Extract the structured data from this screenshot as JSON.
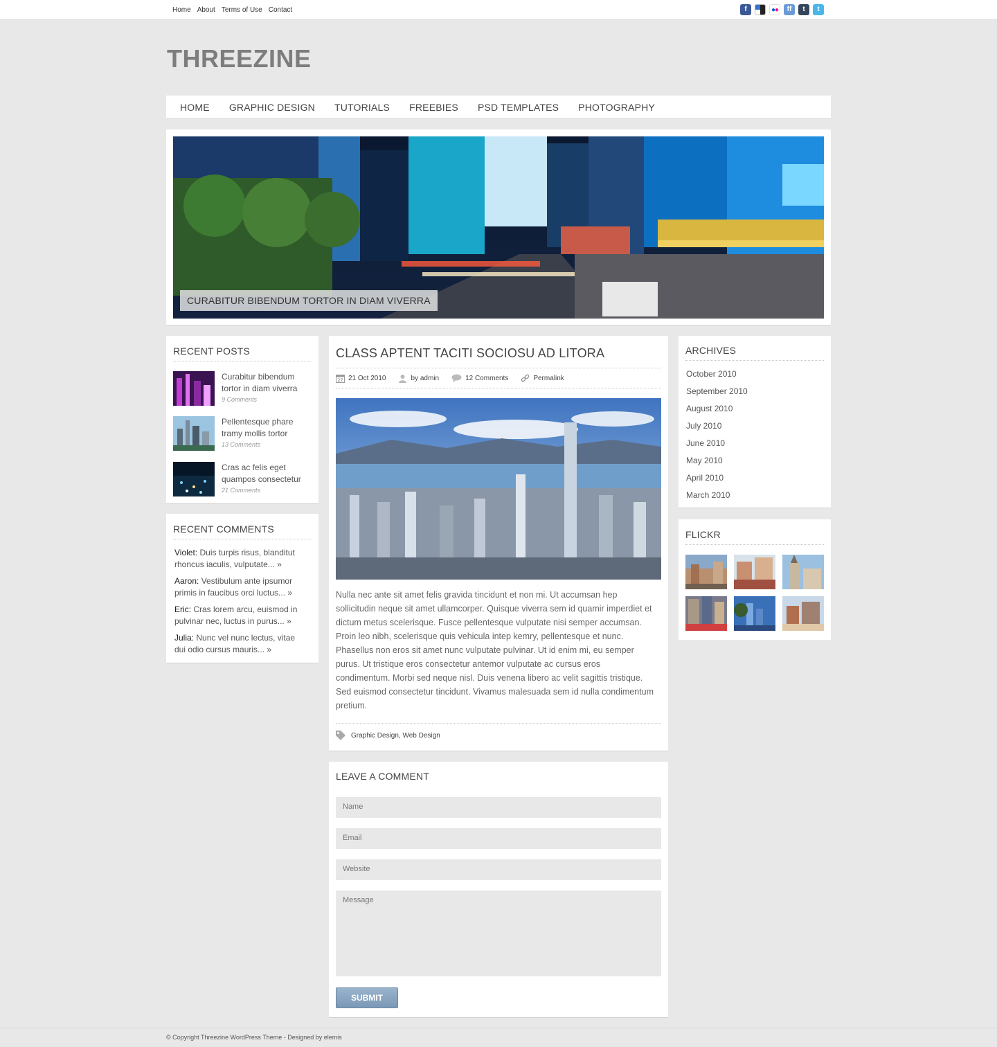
{
  "topbar": {
    "links": [
      "Home",
      "About",
      "Terms of Use",
      "Contact"
    ],
    "social_icons": [
      "facebook-icon",
      "delicious-icon",
      "flickr-icon",
      "friendfeed-icon",
      "tumblr-icon",
      "twitter-icon"
    ]
  },
  "site": {
    "logo": "THREEZINE"
  },
  "nav": {
    "items": [
      "HOME",
      "GRAPHIC DESIGN",
      "TUTORIALS",
      "FREEBIES",
      "PSD TEMPLATES",
      "PHOTOGRAPHY"
    ]
  },
  "slider": {
    "caption": "CURABITUR BIBENDUM TORTOR IN DIAM VIVERRA"
  },
  "recent_posts": {
    "title": "RECENT POSTS",
    "items": [
      {
        "title": "Curabitur bibendum tortor in diam viverra",
        "comments": "9 Comments"
      },
      {
        "title": "Pellentesque phare tramy mollis tortor",
        "comments": "13 Comments"
      },
      {
        "title": "Cras ac felis eget quampos consectetur",
        "comments": "21 Comments"
      }
    ]
  },
  "recent_comments": {
    "title": "RECENT COMMENTS",
    "items": [
      {
        "author": "Violet:",
        "text": "Duis turpis risus, blanditut rhoncus iaculis, vulputate...",
        "more": "»"
      },
      {
        "author": "Aaron:",
        "text": "Vestibulum ante ipsumor primis in faucibus orci luctus...",
        "more": "»"
      },
      {
        "author": "Eric:",
        "text": "Cras lorem arcu, euismod in pulvinar nec, luctus in purus...",
        "more": "»"
      },
      {
        "author": "Julia:",
        "text": "Nunc vel nunc lectus, vitae dui odio cursus mauris...",
        "more": "»"
      }
    ]
  },
  "post": {
    "title": "CLASS APTENT TACITI SOCIOSU AD LITORA",
    "date_icon_day": "27",
    "date": "21 Oct 2010",
    "author": "by admin",
    "comments": "12 Comments",
    "permalink": "Permalink",
    "body": "Nulla nec ante sit amet felis gravida tincidunt et non mi. Ut accumsan hep sollicitudin neque sit amet ullamcorper. Quisque viverra sem id quamir imperdiet et dictum metus scelerisque. Fusce pellentesque vulputate nisi semper accumsan. Proin leo nibh, scelerisque quis vehicula intep kemry, pellentesque et nunc. Phasellus non eros sit amet nunc vulputate pulvinar. Ut id enim mi, eu semper purus. Ut tristique eros consectetur antemor vulputate ac cursus eros condimentum. Morbi sed neque nisl. Duis venena libero ac velit sagittis tristique. Sed euismod consectetur tincidunt. Vivamus malesuada sem id nulla condimentum pretium.",
    "tags": [
      "Graphic Design",
      "Web Design"
    ],
    "tag_separator": ","
  },
  "comment_form": {
    "title": "LEAVE A COMMENT",
    "name_placeholder": "Name",
    "email_placeholder": "Email",
    "website_placeholder": "Website",
    "message_placeholder": "Message",
    "submit_label": "SUBMIT"
  },
  "archives": {
    "title": "ARCHIVES",
    "items": [
      "October 2010",
      "September 2010",
      "August 2010",
      "July 2010",
      "June 2010",
      "May 2010",
      "April 2010",
      "March 2010"
    ]
  },
  "flickr": {
    "title": "FLICKR"
  },
  "footer": {
    "text": "© Copyright Threezine WordPress Theme - Designed by elemis"
  },
  "colors": {
    "background": "#e8e8e8",
    "panel": "#ffffff",
    "submit_button": "#8aa6c2",
    "logo": "#7d7d7d"
  }
}
